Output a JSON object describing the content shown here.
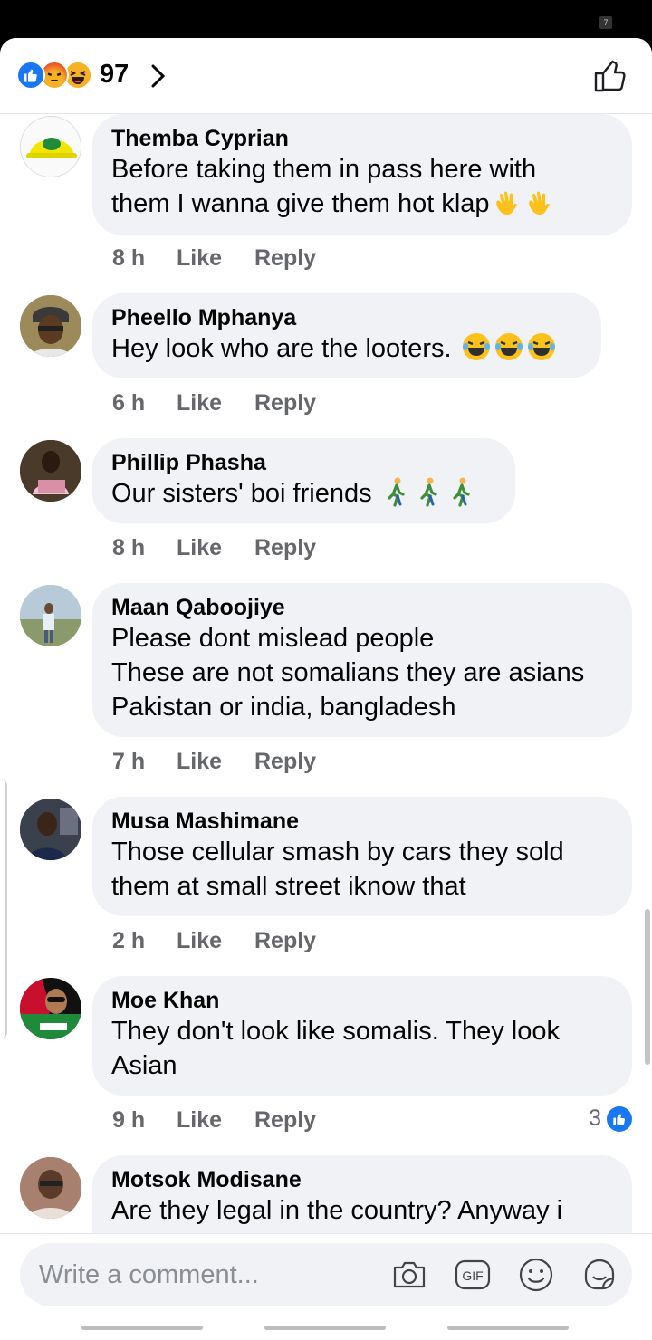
{
  "status": {
    "badge": "7"
  },
  "reactions": {
    "count": "97",
    "types": [
      "like",
      "angry",
      "haha"
    ]
  },
  "comments": [
    {
      "name": "Themba Cyprian",
      "text": "Before taking them in pass here with\nthem I wanna give them hot klap",
      "emoji": "waving-hand",
      "emoji_count": 2,
      "time": "8 h",
      "like": "Like",
      "reply": "Reply"
    },
    {
      "name": "Pheello Mphanya",
      "text": "Hey look who are the looters. ",
      "emoji": "laughing-tears",
      "emoji_count": 3,
      "time": "6 h",
      "like": "Like",
      "reply": "Reply"
    },
    {
      "name": "Phillip Phasha",
      "text": "Our sisters' boi friends ",
      "emoji": "walking-person",
      "emoji_count": 3,
      "time": "8 h",
      "like": "Like",
      "reply": "Reply"
    },
    {
      "name": "Maan Qaboojiye",
      "text": "Please dont mislead people\nThese are not somalians they are asians\nPakistan or india, bangladesh",
      "time": "7 h",
      "like": "Like",
      "reply": "Reply"
    },
    {
      "name": "Musa Mashimane",
      "text": "Those cellular smash by cars they sold\nthem at small street iknow that",
      "time": "2 h",
      "like": "Like",
      "reply": "Reply"
    },
    {
      "name": "Moe Khan",
      "text": "They don't look like somalis. They look\nAsian",
      "time": "9 h",
      "like": "Like",
      "reply": "Reply",
      "reaction_count": "3"
    },
    {
      "name": "Motsok Modisane",
      "text": "Are they legal in the country? Anyway i"
    }
  ],
  "composer": {
    "placeholder": "Write a comment..."
  },
  "colors": {
    "accent": "#1877f2",
    "bubble": "#f0f2f5",
    "meta": "#65676b"
  }
}
